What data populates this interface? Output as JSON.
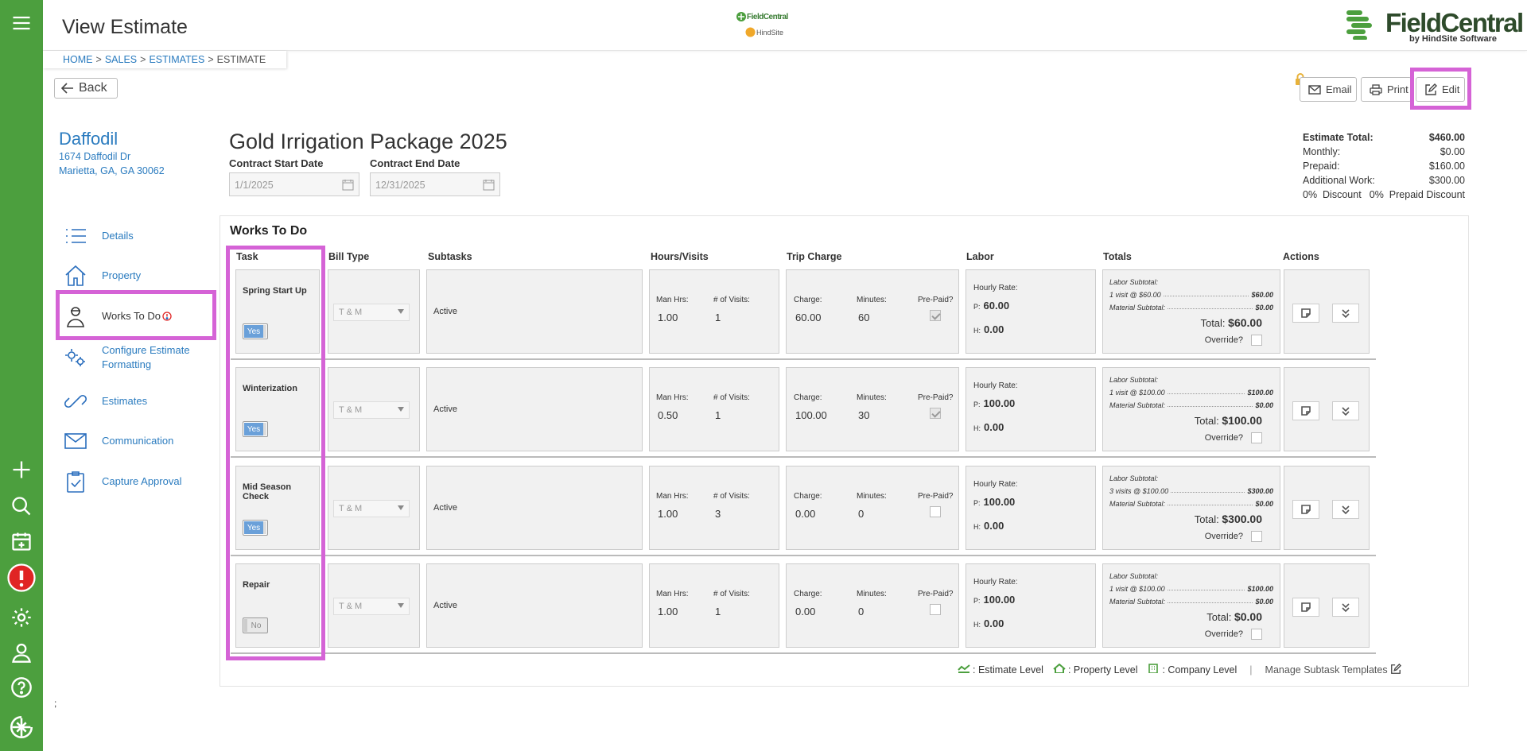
{
  "header": {
    "title": "View Estimate",
    "center_logo_top": "FieldCentral",
    "center_logo_bottom": "HindSite",
    "brand_name": "FieldCentral",
    "brand_tagline": "by HindSite Software"
  },
  "breadcrumb": {
    "items": [
      "HOME",
      "SALES",
      "ESTIMATES",
      "ESTIMATE"
    ],
    "separator": ">"
  },
  "rail": {
    "icons": [
      "menu-icon",
      "add-icon",
      "search-icon",
      "calendar-add-icon",
      "alert-icon",
      "settings-icon",
      "user-icon",
      "help-icon",
      "fieldcentral-logo-icon"
    ]
  },
  "toolbar": {
    "back_label": "Back",
    "email_label": "Email",
    "print_label": "Print",
    "edit_label": "Edit"
  },
  "customer": {
    "name": "Daffodil",
    "address_line1": "1674 Daffodil Dr",
    "address_line2": "Marietta, GA, GA 30062"
  },
  "estimate": {
    "name": "Gold Irrigation Package 2025",
    "start_label": "Contract Start Date",
    "start_value": "1/1/2025",
    "end_label": "Contract End Date",
    "end_value": "12/31/2025"
  },
  "summary": {
    "total_label": "Estimate Total:",
    "total_value": "$460.00",
    "monthly_label": "Monthly:",
    "monthly_value": "$0.00",
    "prepaid_label": "Prepaid:",
    "prepaid_value": "$160.00",
    "additional_label": "Additional Work:",
    "additional_value": "$300.00",
    "discount_pct": "0%",
    "discount_label": "Discount",
    "prepaid_discount_pct": "0%",
    "prepaid_discount_label": "Prepaid Discount"
  },
  "side_nav": {
    "details": "Details",
    "property": "Property",
    "works": "Works To Do",
    "configure": "Configure Estimate Formatting",
    "estimates": "Estimates",
    "communication": "Communication",
    "capture": "Capture Approval"
  },
  "works": {
    "title": "Works To Do",
    "columns": {
      "task": "Task",
      "bill_type": "Bill Type",
      "subtasks": "Subtasks",
      "hours": "Hours/Visits",
      "trip": "Trip Charge",
      "labor": "Labor",
      "totals": "Totals",
      "actions": "Actions"
    },
    "labels": {
      "man_hrs": "Man Hrs:",
      "visits": "# of Visits:",
      "charge": "Charge:",
      "minutes": "Minutes:",
      "prepaid": "Pre-Paid?",
      "hourly_rate": "Hourly Rate:",
      "p_prefix": "P:",
      "h_prefix": "H:",
      "labor_subtotal": "Labor Subtotal:",
      "material_subtotal": "Material Subtotal:",
      "total": "Total:",
      "override": "Override?"
    },
    "rows": [
      {
        "task": "Spring Start Up",
        "toggle": "Yes",
        "bill_type": "T & M",
        "subtask": "Active",
        "man_hrs": "1.00",
        "visits": "1",
        "charge": "60.00",
        "minutes": "60",
        "prepaid": true,
        "rate_p": "60.00",
        "rate_h": "0.00",
        "labor_detail": "1 visit @ $60.00",
        "labor_amt": "$60.00",
        "material_amt": "$0.00",
        "total": "$60.00"
      },
      {
        "task": "Winterization",
        "toggle": "Yes",
        "bill_type": "T & M",
        "subtask": "Active",
        "man_hrs": "0.50",
        "visits": "1",
        "charge": "100.00",
        "minutes": "30",
        "prepaid": true,
        "rate_p": "100.00",
        "rate_h": "0.00",
        "labor_detail": "1 visit @ $100.00",
        "labor_amt": "$100.00",
        "material_amt": "$0.00",
        "total": "$100.00"
      },
      {
        "task": "Mid Season Check",
        "toggle": "Yes",
        "bill_type": "T & M",
        "subtask": "Active",
        "man_hrs": "1.00",
        "visits": "3",
        "charge": "0.00",
        "minutes": "0",
        "prepaid": false,
        "rate_p": "100.00",
        "rate_h": "0.00",
        "labor_detail": "3 visits @ $100.00",
        "labor_amt": "$300.00",
        "material_amt": "$0.00",
        "total": "$300.00"
      },
      {
        "task": "Repair",
        "toggle": "No",
        "bill_type": "T & M",
        "subtask": "Active",
        "man_hrs": "1.00",
        "visits": "1",
        "charge": "0.00",
        "minutes": "0",
        "prepaid": false,
        "rate_p": "100.00",
        "rate_h": "0.00",
        "labor_detail": "1 visit @ $100.00",
        "labor_amt": "$100.00",
        "material_amt": "$0.00",
        "total": "$0.00"
      }
    ]
  },
  "legend": {
    "estimate_level": ": Estimate Level",
    "property_level": ": Property Level",
    "company_level": ": Company Level",
    "divider": "|",
    "manage": "Manage Subtask Templates"
  },
  "footer": {
    "semicolon": ";"
  },
  "colors": {
    "rail": "#4c9f3e",
    "link": "#2a7bbf",
    "highlight": "#d563d6",
    "toggle_on": "#6aa0d9"
  }
}
